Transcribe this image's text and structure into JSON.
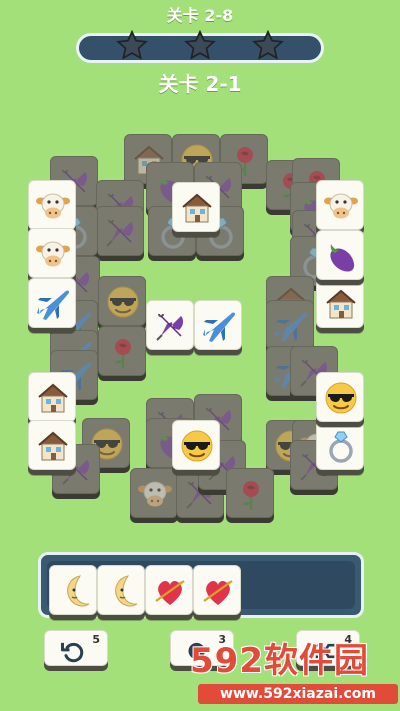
{
  "header": {
    "level_top": "关卡 2-8",
    "level_main": "关卡 2-1",
    "stars_total": 3,
    "progress_fraction": 0.0
  },
  "tiles": [
    {
      "icon": "house",
      "state": "dim"
    },
    {
      "icon": "sunglasses-face",
      "state": "dim"
    },
    {
      "icon": "rose",
      "state": "dim"
    },
    {
      "icon": "umbrella",
      "state": "dim"
    },
    {
      "icon": "eggplant",
      "state": "dim"
    },
    {
      "icon": "umbrella",
      "state": "dim"
    },
    {
      "icon": "ring",
      "state": "dim"
    },
    {
      "icon": "ring",
      "state": "dim"
    },
    {
      "icon": "rose",
      "state": "dim"
    },
    {
      "icon": "rose",
      "state": "dim"
    },
    {
      "icon": "umbrella",
      "state": "dim"
    },
    {
      "icon": "eggplant",
      "state": "dim"
    },
    {
      "icon": "umbrella",
      "state": "dim"
    },
    {
      "icon": "ring",
      "state": "dim"
    },
    {
      "icon": "umbrella",
      "state": "dim"
    },
    {
      "icon": "ring",
      "state": "dim"
    },
    {
      "icon": "umbrella",
      "state": "dim"
    },
    {
      "icon": "sunglasses-face",
      "state": "dim"
    },
    {
      "icon": "house",
      "state": "dim"
    },
    {
      "icon": "airplane",
      "state": "dim"
    },
    {
      "icon": "airplane",
      "state": "dim"
    },
    {
      "icon": "rose",
      "state": "dim"
    },
    {
      "icon": "airplane",
      "state": "dim"
    },
    {
      "icon": "airplane",
      "state": "dim"
    },
    {
      "icon": "umbrella",
      "state": "dim"
    },
    {
      "icon": "airplane",
      "state": "dim"
    },
    {
      "icon": "umbrella",
      "state": "dim"
    },
    {
      "icon": "sunglasses-face",
      "state": "dim"
    },
    {
      "icon": "eggplant",
      "state": "dim"
    },
    {
      "icon": "umbrella",
      "state": "dim"
    },
    {
      "icon": "sunglasses-face",
      "state": "dim"
    },
    {
      "icon": "cow",
      "state": "dim"
    },
    {
      "icon": "umbrella",
      "state": "dim"
    },
    {
      "icon": "cow",
      "state": "dim"
    },
    {
      "icon": "umbrella",
      "state": "dim"
    },
    {
      "icon": "umbrella",
      "state": "dim"
    },
    {
      "icon": "rose",
      "state": "dim"
    },
    {
      "icon": "umbrella",
      "state": "dim"
    },
    {
      "icon": "house",
      "state": "active"
    },
    {
      "icon": "cow",
      "state": "active"
    },
    {
      "icon": "cow",
      "state": "active"
    },
    {
      "icon": "airplane",
      "state": "active"
    },
    {
      "icon": "house",
      "state": "active"
    },
    {
      "icon": "house",
      "state": "active"
    },
    {
      "icon": "umbrella",
      "state": "active"
    },
    {
      "icon": "airplane",
      "state": "active"
    },
    {
      "icon": "cow",
      "state": "active"
    },
    {
      "icon": "eggplant",
      "state": "active"
    },
    {
      "icon": "house",
      "state": "active"
    },
    {
      "icon": "sunglasses-face",
      "state": "active"
    },
    {
      "icon": "ring",
      "state": "active"
    },
    {
      "icon": "sunglasses-face",
      "state": "active"
    }
  ],
  "tray": {
    "slots": [
      {
        "icon": "moon-face"
      },
      {
        "icon": "moon-face"
      },
      {
        "icon": "heart-arrow"
      },
      {
        "icon": "heart-arrow"
      }
    ]
  },
  "tools": [
    {
      "icon": "undo-icon",
      "count": "5"
    },
    {
      "icon": "hint-icon",
      "count": "3"
    },
    {
      "icon": "shuffle-icon",
      "count": "4"
    }
  ],
  "watermark": {
    "logo": "592软件园",
    "url": "www.592xiazai.com"
  },
  "colors": {
    "background": "#a3e07a",
    "tile_face": "#fbfbf3",
    "tile_dim": "#7a7a6e",
    "tray": "#3a5a73",
    "watermark_red": "#e24b3a"
  }
}
